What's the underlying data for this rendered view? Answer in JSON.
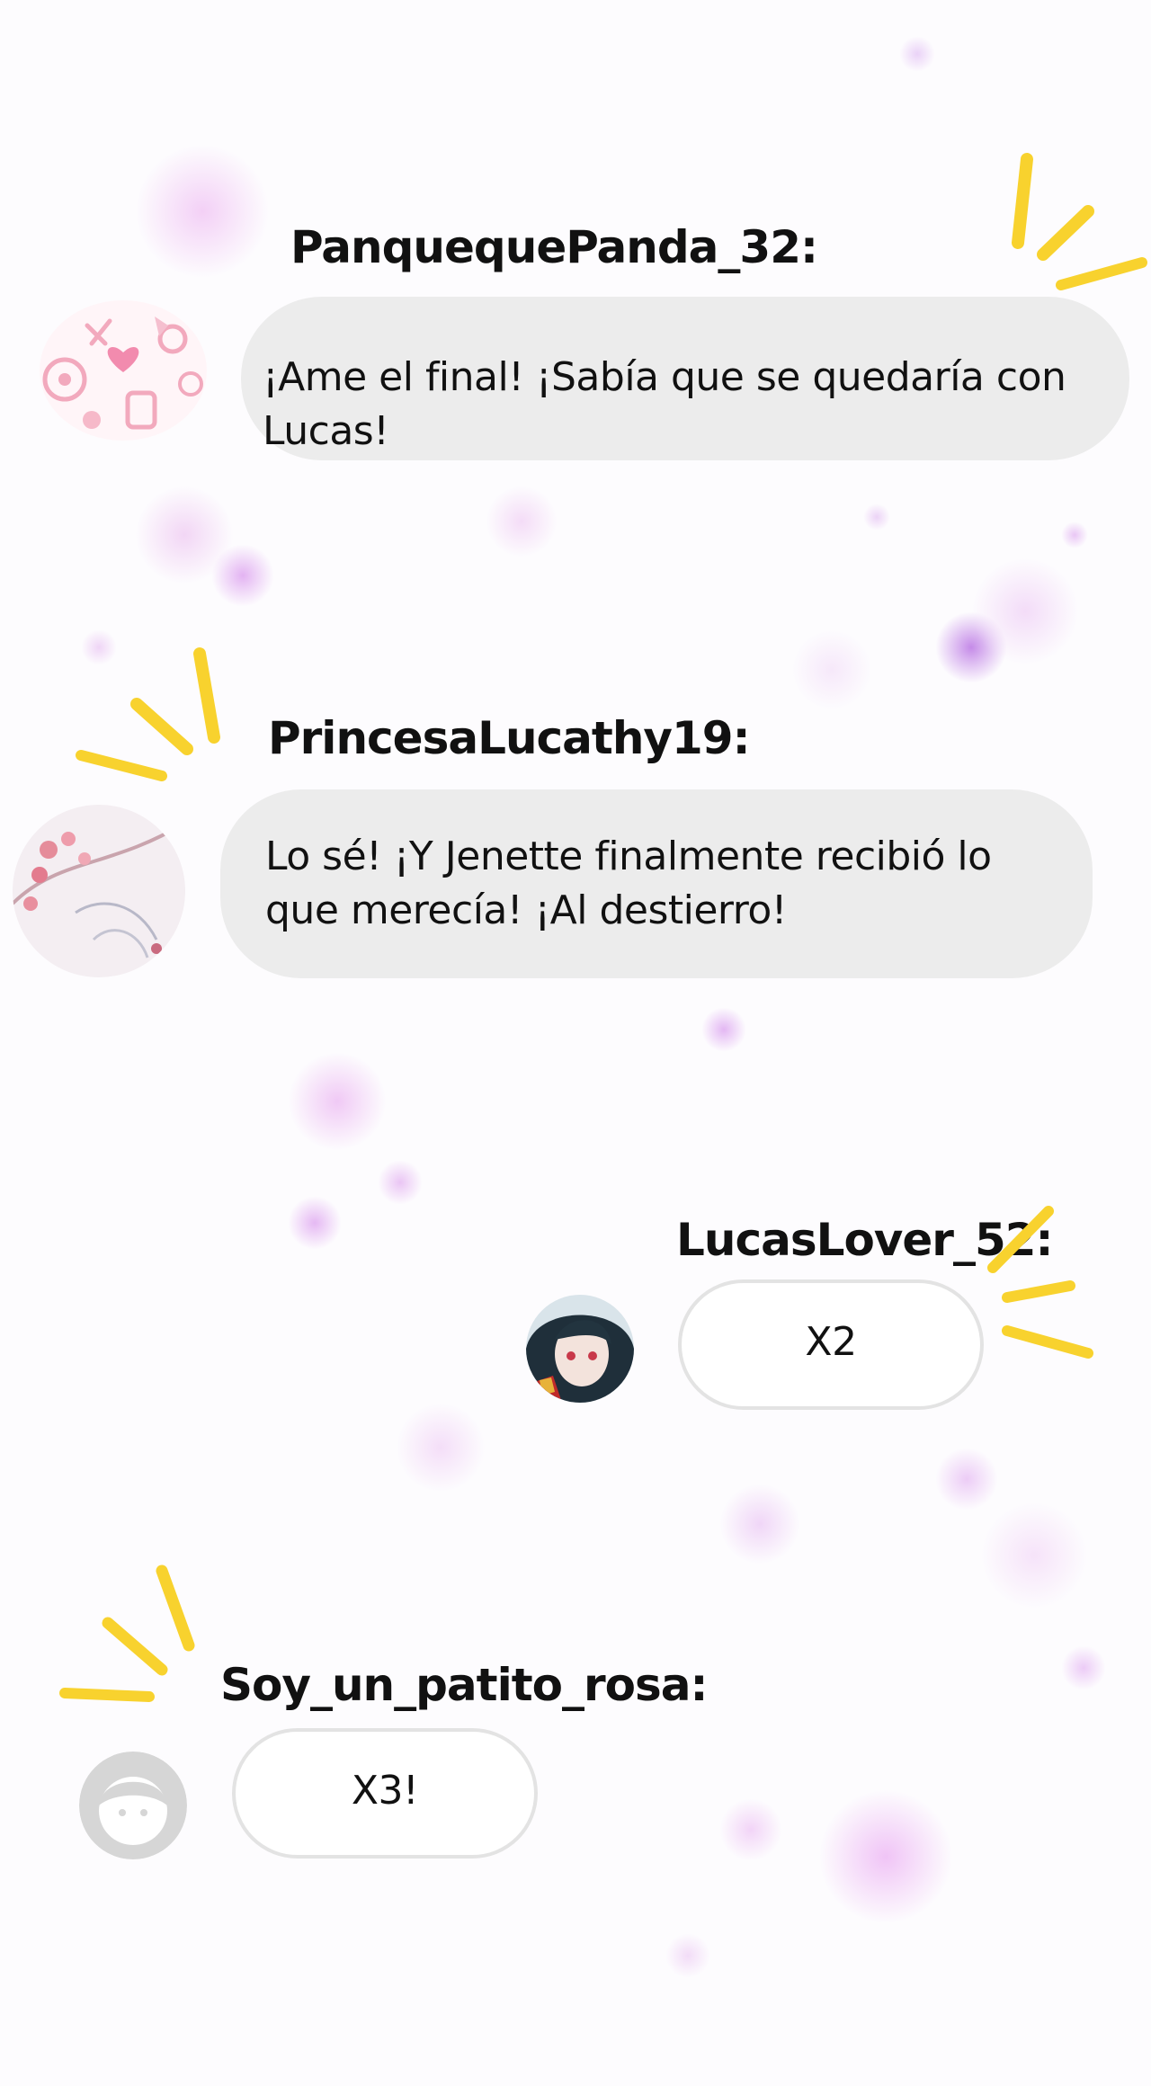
{
  "messages": [
    {
      "username": "PanquequePanda_32:",
      "text": "¡Ame el final! ¡Sabía que se quedaría con Lucas!",
      "avatar": "sweets-pattern-avatar"
    },
    {
      "username": "PrincesaLucathy19:",
      "text": "Lo sé! ¡Y Jenette finalmente recibió lo que merecía! ¡Al destierro!",
      "avatar": "pink-blossom-avatar"
    },
    {
      "username": "LucasLover_52:",
      "text": "X2",
      "avatar": "anime-character-avatar"
    },
    {
      "username": "Soy_un_patito_rosa:",
      "text": "X3!",
      "avatar": "default-user-avatar"
    }
  ],
  "colors": {
    "bubble_gray": "#ececec",
    "bubble_border": "#e3e3e3",
    "accent_yellow": "#f8d22e",
    "blob_purple": "#d9a8f0",
    "text": "#111111"
  },
  "icons": [
    "yellow-burst-icon",
    "sweets-pattern-avatar",
    "pink-blossom-avatar",
    "anime-character-avatar",
    "default-user-avatar"
  ]
}
